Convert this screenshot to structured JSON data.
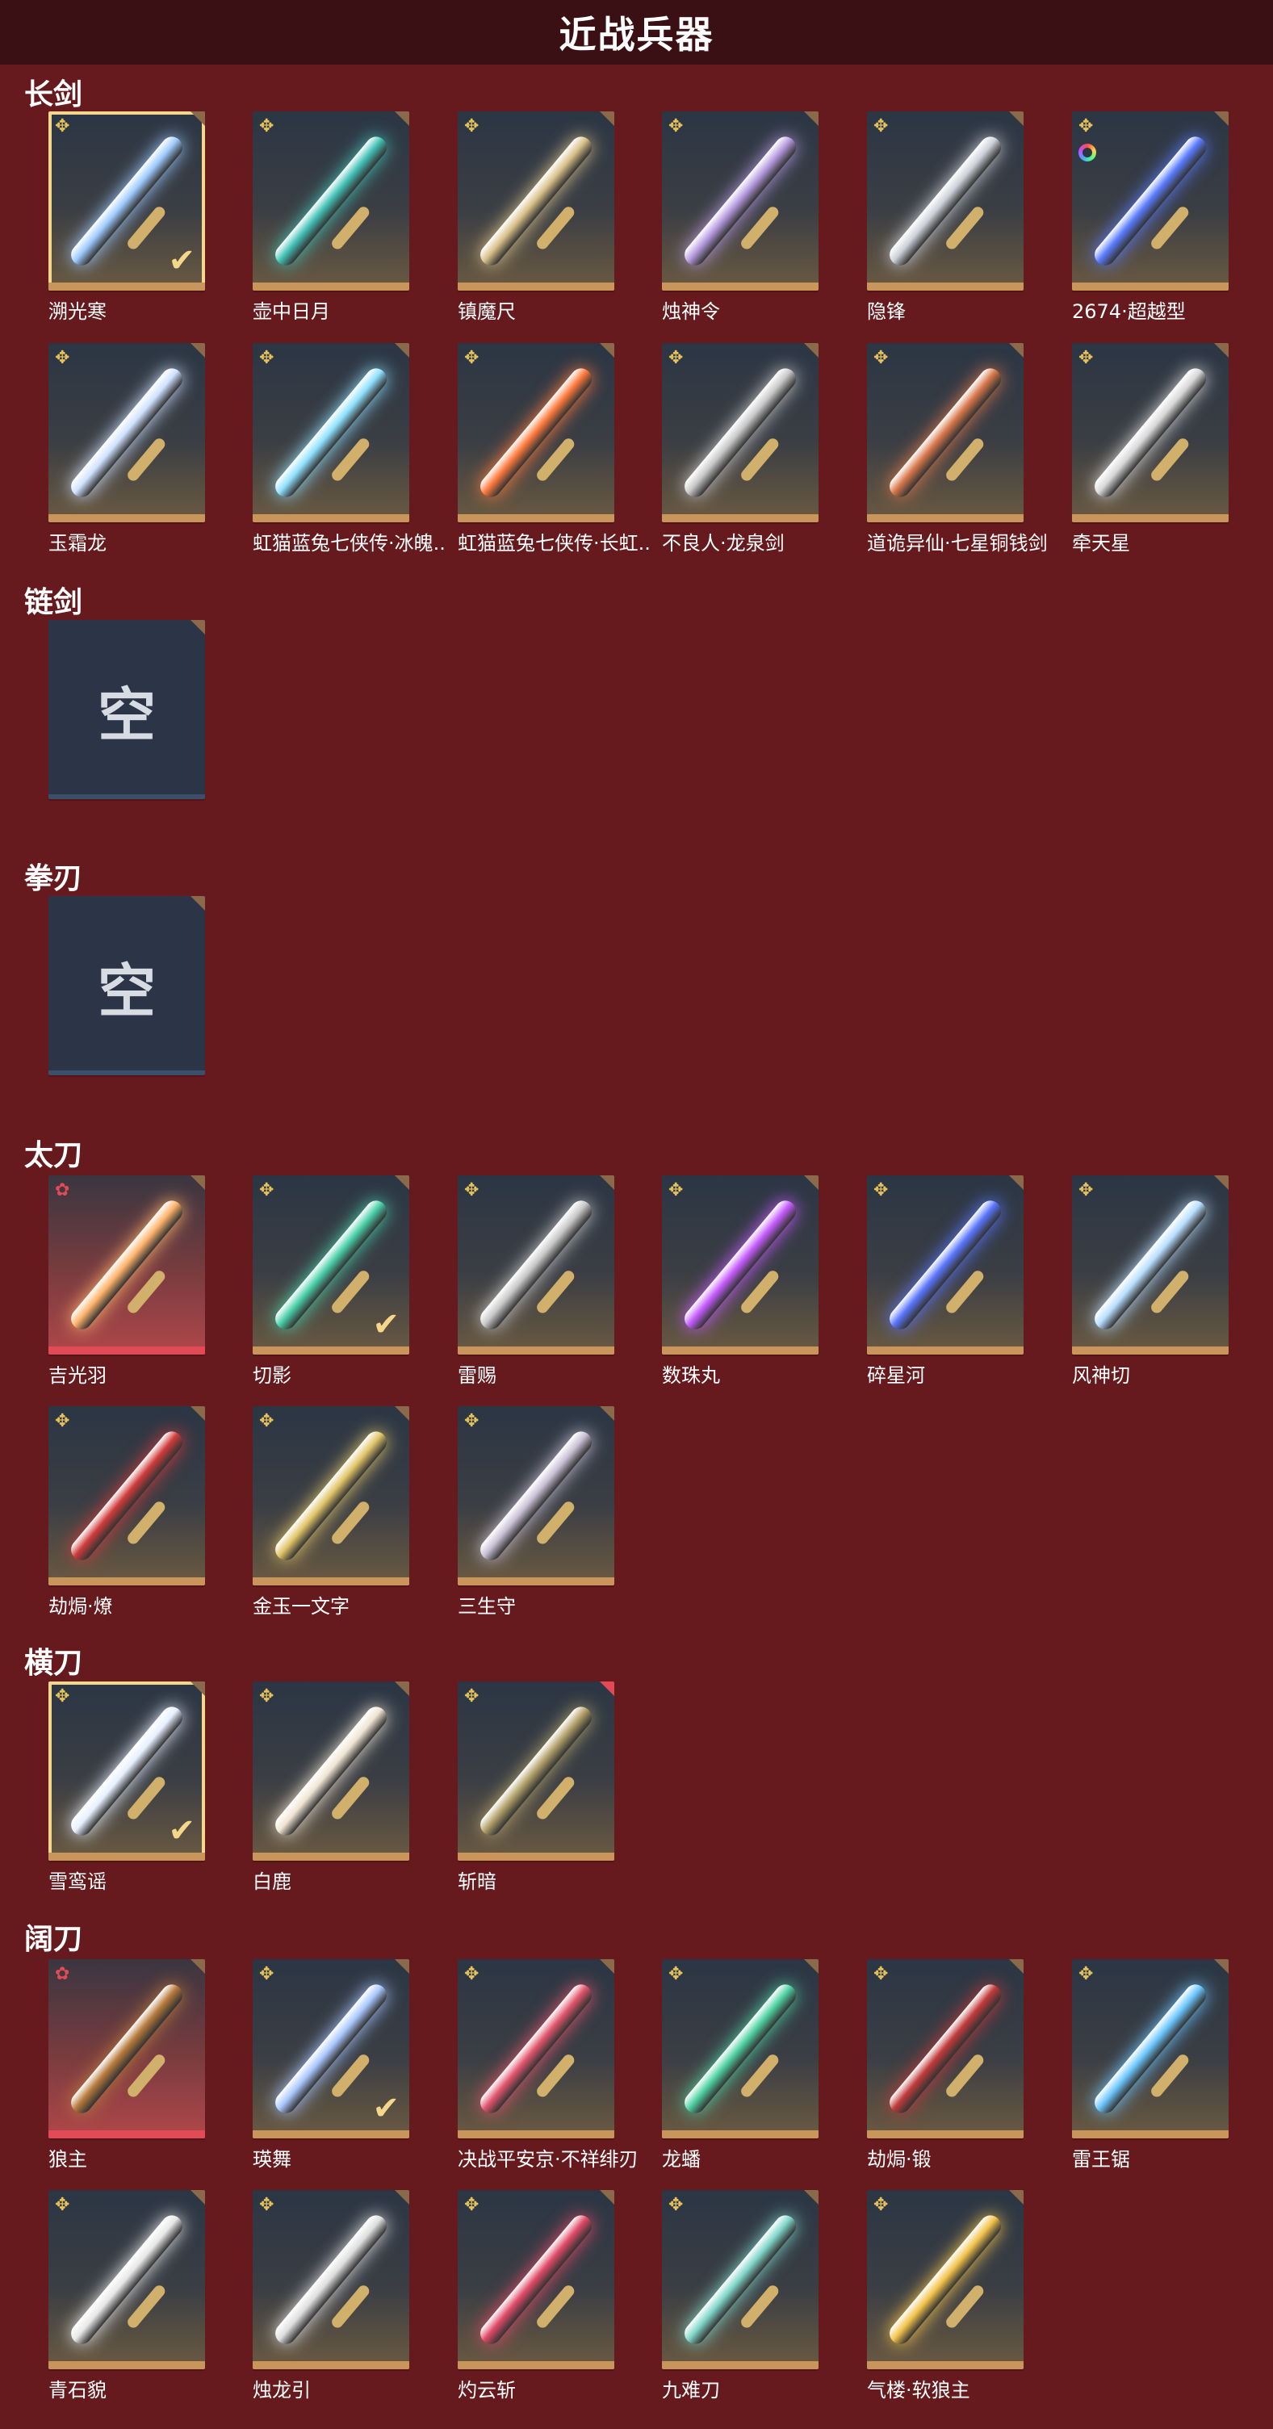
{
  "header": {
    "title": "近战兵器"
  },
  "sections": [
    {
      "id": "longsword",
      "title": "长剑",
      "items": [
        {
          "name": "溯光寒",
          "rank": "gold",
          "selected": true,
          "equipped": true,
          "blade": "#9ecbff"
        },
        {
          "name": "壶中日月",
          "rank": "gold",
          "blade": "#43c2b7"
        },
        {
          "name": "镇魔尺",
          "rank": "gold",
          "blade": "#d8c089"
        },
        {
          "name": "烛神令",
          "rank": "gold",
          "blade": "#b69ae0"
        },
        {
          "name": "隐锋",
          "rank": "gold",
          "blade": "#ccd0d8"
        },
        {
          "name": "2674·超越型",
          "rank": "gold",
          "ring": true,
          "blade": "#5a7cff"
        },
        {
          "name": "玉霜龙",
          "rank": "gold",
          "blade": "#cfe2ff"
        },
        {
          "name": "虹猫蓝兔七侠传·冰魄..",
          "rank": "gold",
          "blade": "#8fe1ff"
        },
        {
          "name": "虹猫蓝兔七侠传·长虹..",
          "rank": "gold",
          "blade": "#ff7a3d"
        },
        {
          "name": "不良人·龙泉剑",
          "rank": "gold",
          "blade": "#c7c7c7"
        },
        {
          "name": "道诡异仙·七星铜钱剑",
          "rank": "gold",
          "blade": "#d9774a"
        },
        {
          "name": "牵天星",
          "rank": "gold",
          "blade": "#d7d7d7"
        }
      ]
    },
    {
      "id": "chainsword",
      "title": "链剑",
      "items": [
        {
          "name": "",
          "empty": true,
          "empty_text": "空"
        }
      ]
    },
    {
      "id": "fistblade",
      "title": "拳刃",
      "items": [
        {
          "name": "",
          "empty": true,
          "empty_text": "空"
        }
      ]
    },
    {
      "id": "katana",
      "title": "太刀",
      "items": [
        {
          "name": "吉光羽",
          "rank": "red",
          "blade": "#ffb36b"
        },
        {
          "name": "切影",
          "rank": "gold",
          "equipped": true,
          "blade": "#4ad0a9"
        },
        {
          "name": "雷赐",
          "rank": "gold",
          "blade": "#c7c7c7"
        },
        {
          "name": "数珠丸",
          "rank": "gold",
          "blade": "#c65cff"
        },
        {
          "name": "碎星河",
          "rank": "gold",
          "blade": "#5a76ff"
        },
        {
          "name": "风神切",
          "rank": "gold",
          "blade": "#b8dfff"
        },
        {
          "name": "劫焗·燎",
          "rank": "gold",
          "blade": "#d13b3b"
        },
        {
          "name": "金玉一文字",
          "rank": "gold",
          "blade": "#e1c569"
        },
        {
          "name": "三生守",
          "rank": "gold",
          "blade": "#c9c0d5"
        }
      ]
    },
    {
      "id": "saber",
      "title": "横刀",
      "items": [
        {
          "name": "雪鸾谣",
          "rank": "gold",
          "selected": true,
          "equipped": true,
          "blade": "#e7f0ff"
        },
        {
          "name": "白鹿",
          "rank": "gold",
          "blade": "#efe4d2"
        },
        {
          "name": "斩暗",
          "rank": "gold",
          "blade": "#b3a26a",
          "red_corner": true
        }
      ]
    },
    {
      "id": "broadblade",
      "title": "阔刀",
      "items": [
        {
          "name": "狼主",
          "rank": "red",
          "blade": "#b87a3c"
        },
        {
          "name": "瑛舞",
          "rank": "gold",
          "equipped": true,
          "blade": "#a9c8ff"
        },
        {
          "name": "决战平安京·不祥绯刃",
          "rank": "gold",
          "blade": "#e2556c"
        },
        {
          "name": "龙蟠",
          "rank": "gold",
          "blade": "#4fd2a3"
        },
        {
          "name": "劫焗·锻",
          "rank": "gold",
          "blade": "#c23a3a"
        },
        {
          "name": "雷王锯",
          "rank": "gold",
          "blade": "#6cc7ff"
        },
        {
          "name": "青石貌",
          "rank": "gold",
          "blade": "#e7e7e7"
        },
        {
          "name": "烛龙引",
          "rank": "gold",
          "blade": "#dedede"
        },
        {
          "name": "灼云斩",
          "rank": "gold",
          "blade": "#e14a67"
        },
        {
          "name": "九难刀",
          "rank": "gold",
          "blade": "#7fd6c9"
        },
        {
          "name": "气楼·软狼主",
          "rank": "gold",
          "blade": "#f3c34b"
        }
      ]
    }
  ],
  "icons": {
    "gold_rank": "✥",
    "red_rank": "✿",
    "check": "✔"
  }
}
